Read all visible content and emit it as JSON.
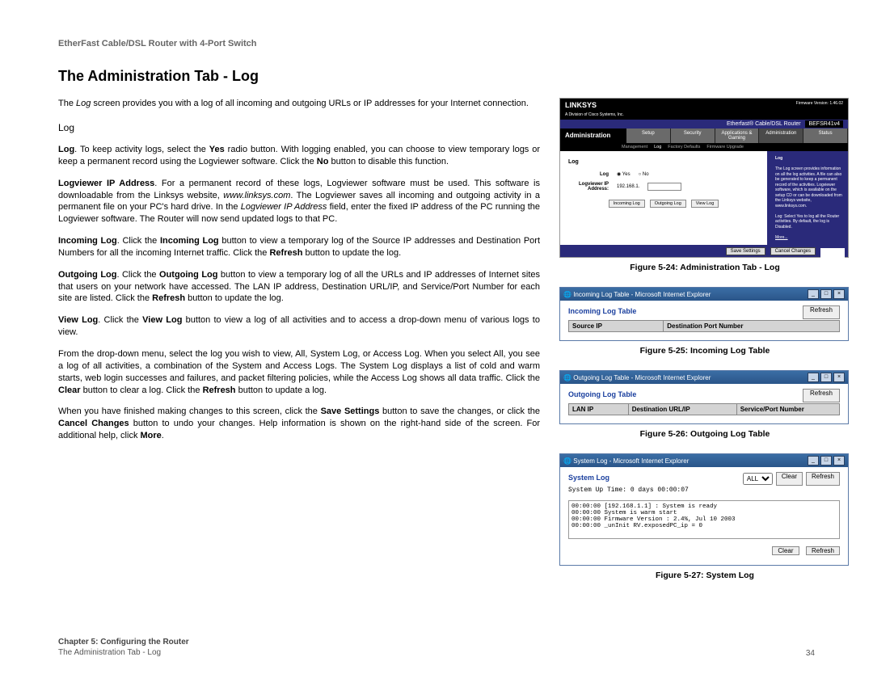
{
  "header": {
    "product": "EtherFast Cable/DSL Router with 4-Port Switch"
  },
  "title": "The Administration Tab - Log",
  "intro": {
    "prefix": "The ",
    "em": "Log",
    "rest": " screen provides you with a log of all incoming and outgoing URLs or IP addresses for your Internet connection."
  },
  "section_heading": "Log",
  "paragraphs": {
    "p1a": "Log",
    "p1b": ". To keep activity logs, select the ",
    "p1c": "Yes",
    "p1d": " radio button. With logging enabled, you can choose to view temporary logs or keep a permanent record using the Logviewer software. Click the ",
    "p1e": "No",
    "p1f": " button to disable this function.",
    "p2a": "Logviewer IP Address",
    "p2b": ". For a permanent record of these logs, Logviewer software must be used. This software is downloadable from the Linksys website, ",
    "p2c": "www.linksys.com",
    "p2d": ". The Logviewer saves all incoming and outgoing activity in a permanent file on your PC's hard drive. In the ",
    "p2e": "Logviewer IP Address",
    "p2f": " field, enter the fixed IP address of the PC running the Logviewer software. The Router will now send updated logs to that PC.",
    "p3a": "Incoming Log",
    "p3b": ". Click the ",
    "p3c": "Incoming Log",
    "p3d": " button to view a temporary log of the Source IP addresses and Destination Port Numbers for all the incoming Internet traffic. Click the ",
    "p3e": "Refresh",
    "p3f": " button to update the log.",
    "p4a": "Outgoing Log",
    "p4b": ". Click the ",
    "p4c": "Outgoing Log",
    "p4d": " button to view a temporary log of all the URLs and IP addresses of Internet sites that users on your network have accessed. The LAN IP address, Destination URL/IP, and Service/Port Number for each site are listed. Click the ",
    "p4e": "Refresh",
    "p4f": " button to update the log.",
    "p5a": "View Log",
    "p5b": ". Click the ",
    "p5c": "View Log",
    "p5d": " button to view a log of all activities and to access a drop-down menu of various logs to view.",
    "p6a": "From the drop-down menu, select the log you wish to view, All, System Log, or Access Log. When you select All, you see a log of all activities, a combination of the System and Access Logs. The System Log displays a list of cold and warm starts, web login successes and failures, and packet filtering policies, while the Access Log shows all data traffic. Click the ",
    "p6b": "Clear",
    "p6c": " button to clear a log. Click the ",
    "p6d": "Refresh",
    "p6e": " button to update a log.",
    "p7a": "When you have finished making changes to this screen, click the ",
    "p7b": "Save Settings",
    "p7c": " button to save the changes, or click the ",
    "p7d": "Cancel Changes",
    "p7e": " button to undo your changes. Help information is shown on the right-hand side of the screen. For additional help, click ",
    "p7f": "More",
    "p7g": "."
  },
  "figures": {
    "f24": {
      "caption": "Figure 5-24: Administration Tab - Log",
      "brand": "LINKSYS",
      "brand_sub": "A Division of Cisco Systems, Inc.",
      "firmware": "Firmware Version: 1.46.02",
      "model_line": "Etherfast® Cable/DSL Router",
      "model_code": "BEFSR41v4",
      "admin_label": "Administration",
      "tabs": [
        "Setup",
        "Security",
        "Applications & Gaming",
        "Administration",
        "Status"
      ],
      "subtabs": [
        "Management",
        "Log",
        "Factory Defaults",
        "Firmware Upgrade"
      ],
      "log_label": "Log",
      "log_yes": "Yes",
      "log_no": "No",
      "logviewer_label": "Logviewer IP Address:",
      "logviewer_ip": "192.168.1.",
      "btn_incoming": "Incoming Log",
      "btn_outgoing": "Outgoing Log",
      "btn_view": "View Log",
      "help_text": "The Log screen provides information on all the log activities. A file can also be generated to keep a permanent record of the activities. Logviewer software, which is available on the setup CD or can be downloaded from the Linksys website, www.linksys.com.",
      "help_log": "Log: Select Yes to log all the Router activities. By default, the log is Disabled.",
      "help_more": "More...",
      "save": "Save Settings",
      "cancel": "Cancel Changes"
    },
    "f25": {
      "caption": "Figure 5-25: Incoming Log Table",
      "titlebar": "Incoming Log Table - Microsoft Internet Explorer",
      "heading": "Incoming Log Table",
      "refresh": "Refresh",
      "col1": "Source IP",
      "col2": "Destination Port Number"
    },
    "f26": {
      "caption": "Figure 5-26: Outgoing Log Table",
      "titlebar": "Outgoing Log Table - Microsoft Internet Explorer",
      "heading": "Outgoing Log Table",
      "refresh": "Refresh",
      "col1": "LAN IP",
      "col2": "Destination URL/IP",
      "col3": "Service/Port Number"
    },
    "f27": {
      "caption": "Figure 5-27: System Log",
      "titlebar": "System Log - Microsoft Internet Explorer",
      "heading": "System Log",
      "uptime": "System Up Time: 0 days 00:00:07",
      "dropdown": "ALL",
      "clear": "Clear",
      "refresh": "Refresh",
      "lines": [
        "00:00:00 [192.168.1.1] : System is ready",
        "00:00:00 System is warm start",
        "00:00:00 Firmware Version : 2.4%, Jul 10 2003",
        "00:00:00 _unInit RV.exposedPC_ip = 0"
      ]
    }
  },
  "footer": {
    "chapter": "Chapter 5: Configuring the Router",
    "section": "The Administration Tab - Log",
    "page": "34"
  }
}
